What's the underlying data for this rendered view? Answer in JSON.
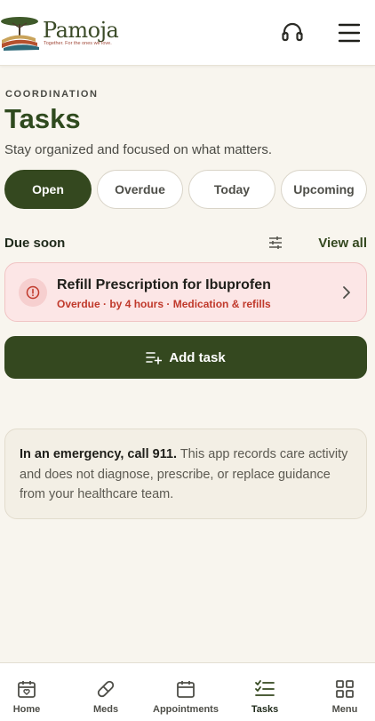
{
  "brand": {
    "name": "Pamoja",
    "tagline": "Together. For the ones we love."
  },
  "header": {
    "support_icon": "headset-icon",
    "menu_icon": "hamburger-icon"
  },
  "page": {
    "eyebrow": "COORDINATION",
    "title": "Tasks",
    "subtitle": "Stay organized and focused on what matters."
  },
  "filters": [
    {
      "label": "Open",
      "active": true
    },
    {
      "label": "Overdue",
      "active": false
    },
    {
      "label": "Today",
      "active": false
    },
    {
      "label": "Upcoming",
      "active": false
    }
  ],
  "due_soon": {
    "title": "Due soon",
    "filter_icon": "sliders-icon",
    "view_all": "View all"
  },
  "tasks": [
    {
      "title": "Refill Prescription for Ibuprofen",
      "meta": "Overdue · by 4 hours · Medication & refills",
      "status": "overdue",
      "icon": "alert-circle-icon"
    }
  ],
  "add_task": {
    "label": "Add task",
    "icon": "add-list-icon"
  },
  "notice": {
    "bold": "In an emergency, call 911.",
    "text": " This app records care activity and does not diagnose, prescribe, or replace guidance from your healthcare team."
  },
  "nav": [
    {
      "label": "Home",
      "icon": "calendar-heart-icon",
      "active": false
    },
    {
      "label": "Meds",
      "icon": "pill-icon",
      "active": false
    },
    {
      "label": "Appointments",
      "icon": "calendar-icon",
      "active": false
    },
    {
      "label": "Tasks",
      "icon": "checklist-icon",
      "active": true
    },
    {
      "label": "Menu",
      "icon": "grid-icon",
      "active": false
    }
  ],
  "colors": {
    "primary": "#34481f",
    "background": "#f8f5ee",
    "overdue_bg": "#fce6e6",
    "overdue_text": "#c0392b"
  }
}
